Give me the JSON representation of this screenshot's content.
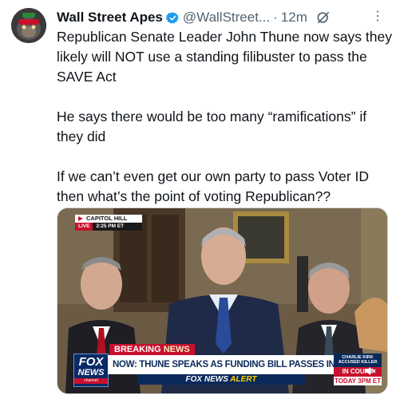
{
  "tweet": {
    "author_name": "Wall Street Apes",
    "handle": "@WallStreet...",
    "separator": "·",
    "time": "12m",
    "more": "⋮",
    "paragraphs": [
      "Republican Senate Leader John Thune now says they likely will NOT use a standing filibuster to pass the SAVE Act",
      "He says there would be too many “ramifications” if they did",
      "If we can’t even get our own party to pass Voter ID then what’s the point of voting Republican??"
    ]
  },
  "video": {
    "bug_location": "CAPITOL HILL",
    "bug_live": "LIVE",
    "bug_time": "2:25 PM ET",
    "breaking_1": "BREAKING",
    "breaking_2": "NEWS",
    "logo_line1": "FOX",
    "logo_line2": "NEWS",
    "logo_line3": "channel",
    "headline": "NOW: THUNE SPEAKS AS FUNDING BILL PASSES IN HOUSE",
    "alert_1": "FOX NEWS",
    "alert_2": "ALERT",
    "side_top": "CHARLIE KIRK ACCUSED KILLER",
    "side_mid": "IN COURT",
    "side_bot": "TODAY 3PM ET",
    "mute_icon": "speaker-muted-icon"
  },
  "colors": {
    "verified": "#1d9bf0",
    "fox_red": "#c8102e",
    "fox_navy": "#0b2a5c"
  }
}
